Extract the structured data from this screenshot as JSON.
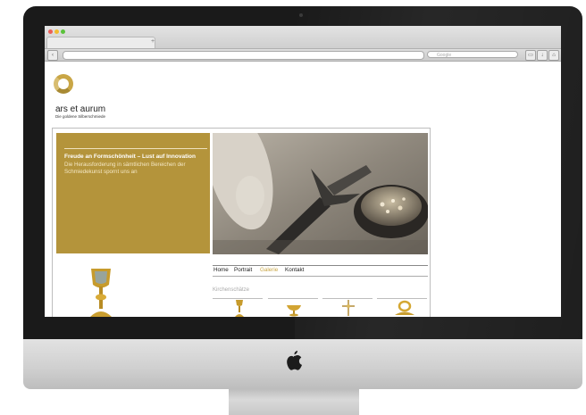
{
  "browser": {
    "traffic_lights": [
      "#ec5f57",
      "#f2bc2f",
      "#5bc23b"
    ],
    "new_tab_label": "+",
    "search_placeholder": "Google"
  },
  "site": {
    "name": "ars et aurum",
    "tagline": "Die goldene Silberschmiede",
    "headline": "Freude an Formschönheit – Lust auf Innovation",
    "subline": "Die Herausforderung in sämtlichen Bereichen der Schmiedekunst spornt uns an",
    "menu": [
      {
        "label": "Home",
        "active": false
      },
      {
        "label": "Portrait",
        "active": false
      },
      {
        "label": "Galerie",
        "active": true
      },
      {
        "label": "Kontakt",
        "active": false
      }
    ],
    "section_title": "Kirchenschätze",
    "colors": {
      "gold": "#b4943b",
      "accent": "#c9a646"
    }
  }
}
